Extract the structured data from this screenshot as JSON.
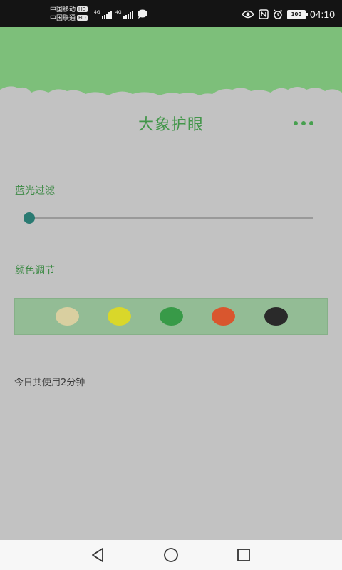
{
  "status_bar": {
    "carrier1": "中国移动",
    "carrier2": "中国联通",
    "hd_badge": "HD",
    "net1": "4G",
    "net2": "4G",
    "battery": "100",
    "time": "04:10",
    "icons": [
      "signal-icon",
      "chat-bubble-icon",
      "eye-icon",
      "nfc-icon",
      "alarm-icon",
      "battery-icon"
    ]
  },
  "header": {
    "title": "大象护眼",
    "more_icon": "more-dots-icon",
    "accent_color": "#7dbf7a"
  },
  "blue_light": {
    "label": "蓝光过滤",
    "slider_value": 0.0
  },
  "color_adjust": {
    "label": "颜色调节",
    "swatches": [
      {
        "color": "#d9cfa0"
      },
      {
        "color": "#d9d72a"
      },
      {
        "color": "#389a48"
      },
      {
        "color": "#d9562e"
      },
      {
        "color": "#2a2a2a"
      }
    ]
  },
  "usage": {
    "text": "今日共使用2分钟"
  },
  "nav": {
    "back_icon": "back-triangle-icon",
    "home_icon": "home-circle-icon",
    "recent_icon": "recent-square-icon"
  }
}
